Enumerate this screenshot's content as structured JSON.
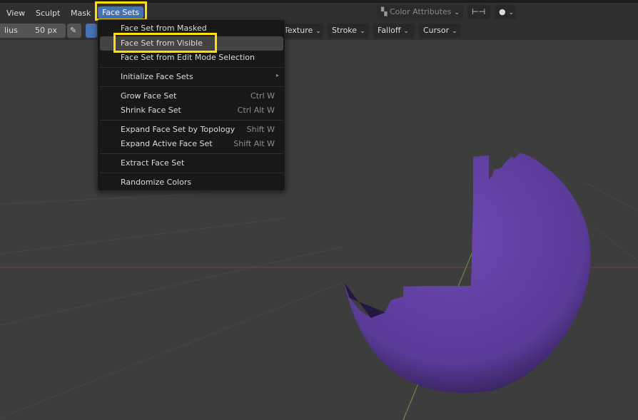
{
  "header": {
    "menus": [
      "View",
      "Sculpt",
      "Mask",
      "Face Sets"
    ],
    "active_menu": "Face Sets",
    "color_attributes": "Color Attributes"
  },
  "toolbar": {
    "radius_label": "lius",
    "radius_value": "50 px",
    "buttons": [
      "Texture",
      "Stroke",
      "Falloff",
      "Cursor"
    ]
  },
  "dropdown": {
    "items": [
      {
        "label": "Face Set from Masked",
        "shortcut": ""
      },
      {
        "label": "Face Set from Visible",
        "shortcut": "",
        "highlighted": true
      },
      {
        "label": "Face Set from Edit Mode Selection",
        "shortcut": ""
      },
      {
        "label": "Initialize Face Sets",
        "shortcut": "",
        "submenu": true
      },
      {
        "label": "Grow Face Set",
        "shortcut": "Ctrl W"
      },
      {
        "label": "Shrink Face Set",
        "shortcut": "Ctrl Alt W"
      },
      {
        "label": "Expand Face Set by Topology",
        "shortcut": "Shift W"
      },
      {
        "label": "Expand Active Face Set",
        "shortcut": "Shift Alt W"
      },
      {
        "label": "Extract Face Set",
        "shortcut": ""
      },
      {
        "label": "Randomize Colors",
        "shortcut": ""
      }
    ],
    "submenu_arrow": "▸"
  },
  "colors": {
    "accent": "#4772b3",
    "highlight": "#ffe000",
    "mesh": "#5e3e9a"
  }
}
